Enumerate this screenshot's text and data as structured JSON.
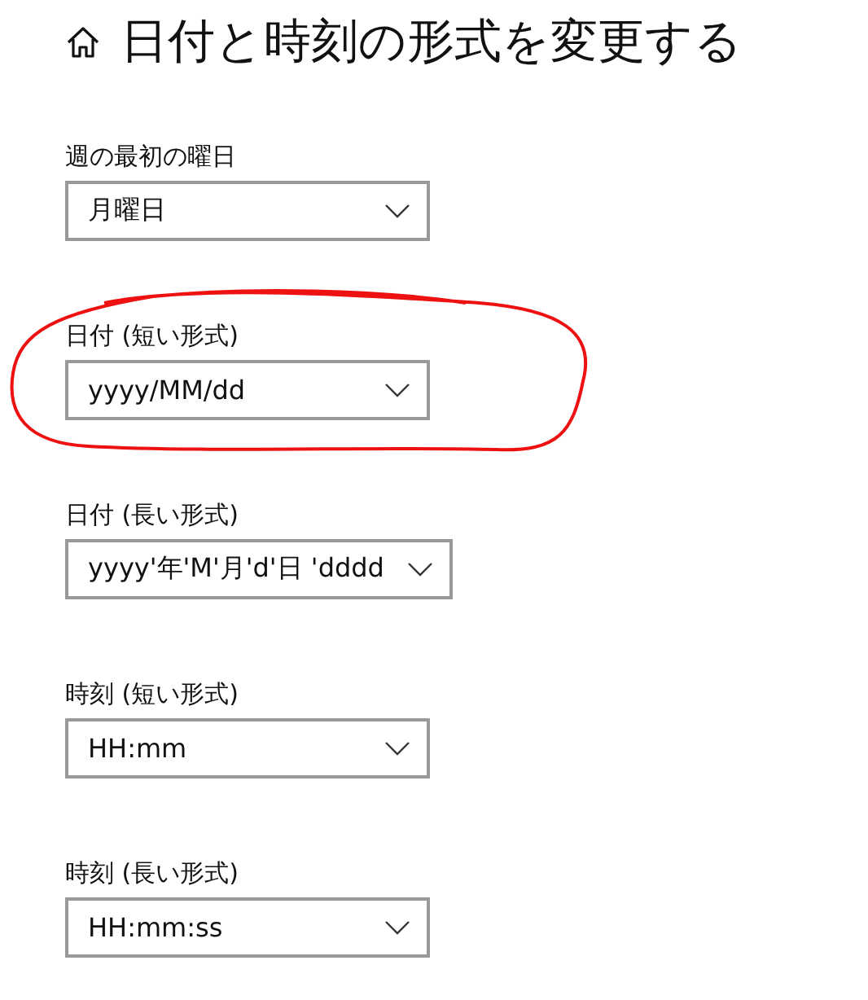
{
  "title": "日付と時刻の形式を変更する",
  "settings": [
    {
      "label": "週の最初の曜日",
      "value": "月曜日",
      "circled": false
    },
    {
      "label": "日付 (短い形式)",
      "value": "yyyy/MM/dd",
      "circled": true
    },
    {
      "label": "日付 (長い形式)",
      "value": "yyyy'年'M'月'd'日 'dddd",
      "circled": false
    },
    {
      "label": "時刻 (短い形式)",
      "value": "HH:mm",
      "circled": false
    },
    {
      "label": "時刻 (長い形式)",
      "value": "HH:mm:ss",
      "circled": false
    }
  ]
}
